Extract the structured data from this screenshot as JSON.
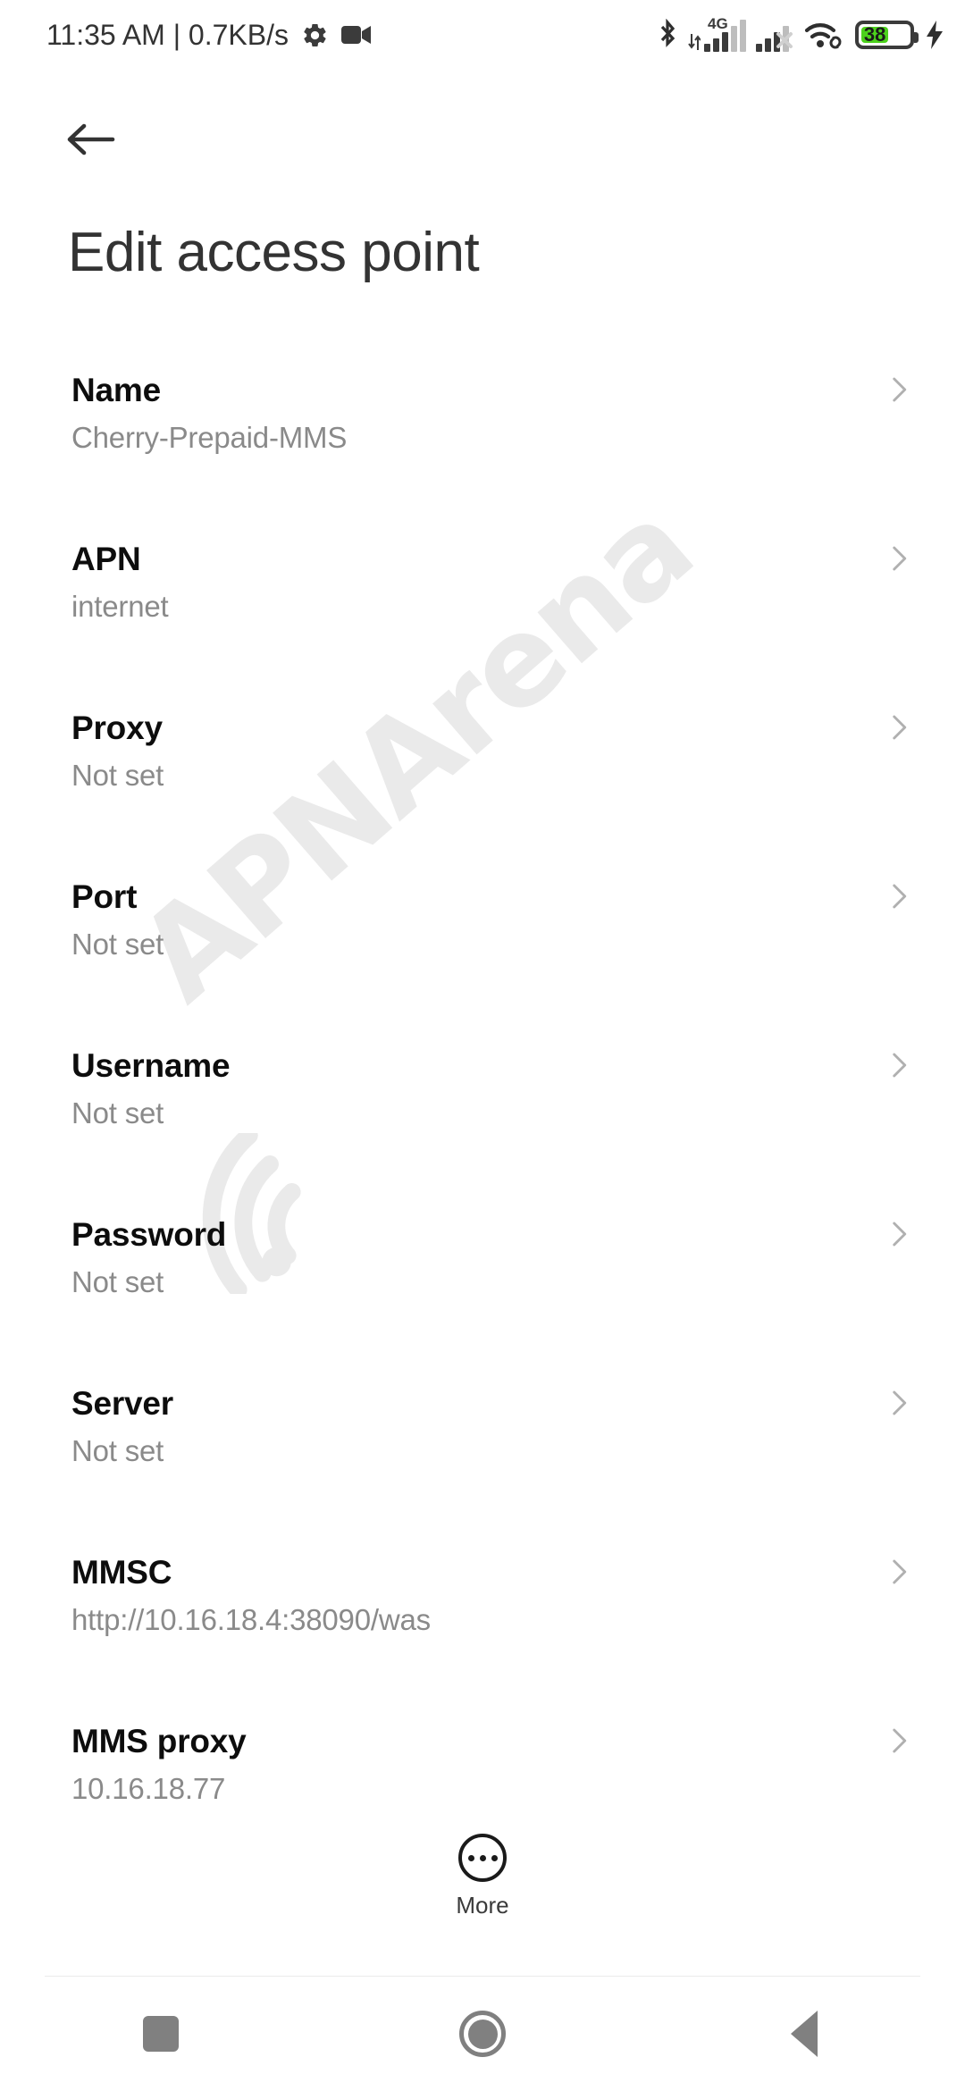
{
  "status_bar": {
    "clock": "11:35 AM | 0.7KB/s",
    "gear_icon": "gear-icon",
    "recording_icon": "video-camera-icon",
    "bluetooth_icon": "bluetooth-icon",
    "network_label": "4G",
    "sim1_icon": "signal-bars-4g-icon",
    "sim2_icon": "signal-bars-no-service-icon",
    "wifi_icon": "wifi-linked-icon",
    "battery_level": "38",
    "battery_color": "#4cd21c",
    "charging_icon": "charging-bolt-icon"
  },
  "header": {
    "back_icon": "back-arrow-icon",
    "title": "Edit access point"
  },
  "list": {
    "chevron_icon": "chevron-right-icon",
    "items": [
      {
        "title": "Name",
        "value": "Cherry-Prepaid-MMS"
      },
      {
        "title": "APN",
        "value": "internet"
      },
      {
        "title": "Proxy",
        "value": "Not set"
      },
      {
        "title": "Port",
        "value": "Not set"
      },
      {
        "title": "Username",
        "value": "Not set"
      },
      {
        "title": "Password",
        "value": "Not set"
      },
      {
        "title": "Server",
        "value": "Not set"
      },
      {
        "title": "MMSC",
        "value": "http://10.16.18.4:38090/was"
      },
      {
        "title": "MMS proxy",
        "value": "10.16.18.77"
      }
    ]
  },
  "more_button": {
    "icon": "more-dots-circle-icon",
    "label": "More"
  },
  "nav_bar": {
    "recents_icon": "recents-square-icon",
    "home_icon": "home-circle-icon",
    "back_icon": "back-triangle-icon"
  },
  "watermark": {
    "text": "APNArena",
    "color": "#eaeaea",
    "logo_icon": "wifi-arcs-icon"
  }
}
